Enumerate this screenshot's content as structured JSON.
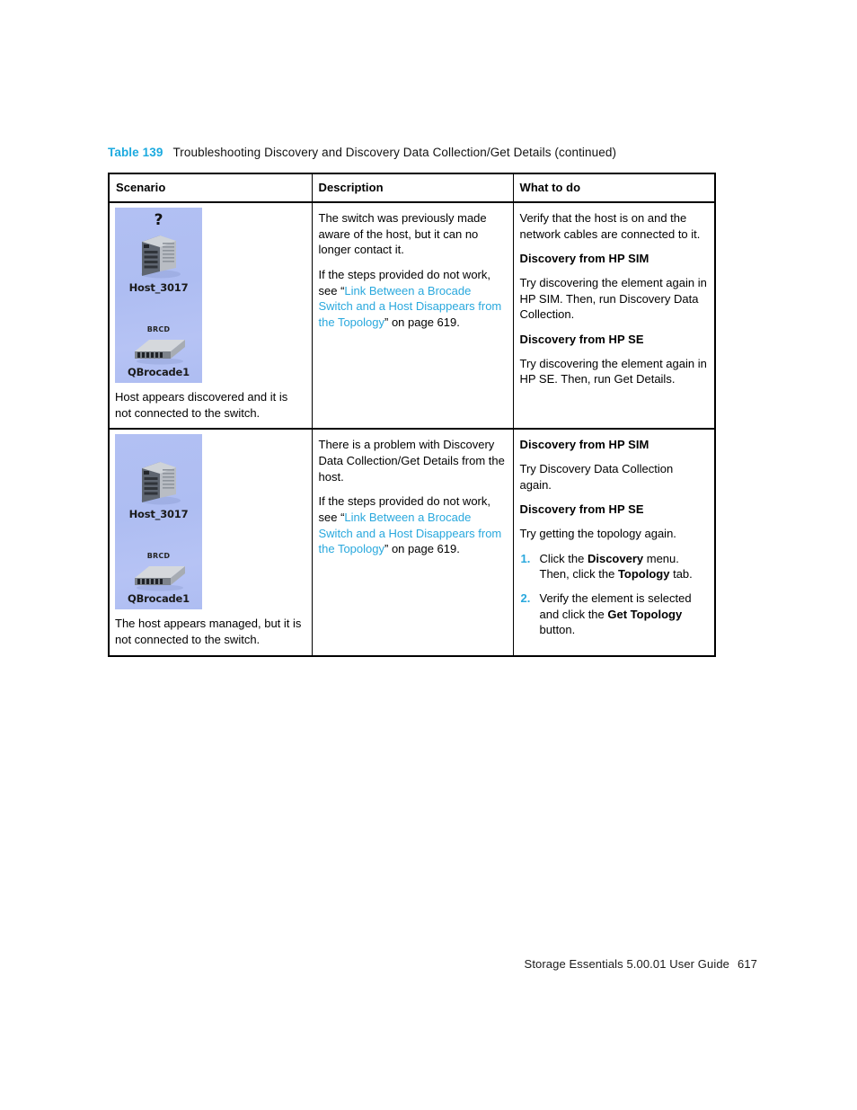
{
  "caption": {
    "number": "Table 139",
    "title": "Troubleshooting Discovery and Discovery Data Collection/Get Details (continued)"
  },
  "colors": {
    "link": "#29A8DD",
    "caption_number": "#1CAADF",
    "topology_background": "#AEBDF2"
  },
  "table": {
    "headers": [
      "Scenario",
      "Description",
      "What to do"
    ],
    "rows": [
      {
        "scenario": {
          "host": {
            "top_marker": "?",
            "label": "Host_3017"
          },
          "switch": {
            "vendor_label": "BRCD",
            "label": "QBrocade1"
          },
          "caption": "Host appears discovered and it is not connected to the switch."
        },
        "description": {
          "para1": "The switch was previously made aware of the host, but it can no longer contact it.",
          "para2_prefix": "If the steps provided do not work, see “",
          "link_text": "Link Between a Brocade Switch and a Host Disappears from the Topology",
          "para2_suffix": "” on page 619."
        },
        "what_to_do": {
          "intro": "Verify that the host is on and the network cables are connected to it.",
          "sections": [
            {
              "heading": "Discovery from HP SIM",
              "body": "Try discovering the element again in HP SIM. Then, run Discovery Data Collection."
            },
            {
              "heading": "Discovery from HP SE",
              "body": "Try discovering the element again in HP SE. Then, run Get Details."
            }
          ]
        }
      },
      {
        "scenario": {
          "host": {
            "top_marker": "",
            "label": "Host_3017"
          },
          "switch": {
            "vendor_label": "BRCD",
            "label": "QBrocade1"
          },
          "caption": "The host appears managed, but it is not connected to the switch."
        },
        "description": {
          "para1": "There is a problem with Discovery Data Collection/Get Details from the host.",
          "para2_prefix": "If the steps provided do not work, see “",
          "link_text": "Link Between a Brocade Switch and a Host Disappears from the Topology",
          "para2_suffix": "” on page 619."
        },
        "what_to_do": {
          "sim_heading": "Discovery from HP SIM",
          "sim_body": "Try Discovery Data Collection again.",
          "se_heading": "Discovery from HP SE",
          "se_body": "Try getting the topology again.",
          "steps": [
            {
              "part1": "Click the ",
              "bold1": "Discovery",
              "part2": " menu. Then, click the ",
              "bold2": "Topology",
              "part3": " tab."
            },
            {
              "part1": "Verify the element is selected and click the ",
              "bold1": "Get Topology",
              "part2": " button."
            }
          ]
        }
      }
    ]
  },
  "footer": {
    "text": "Storage Essentials 5.00.01 User Guide",
    "page": "617"
  }
}
